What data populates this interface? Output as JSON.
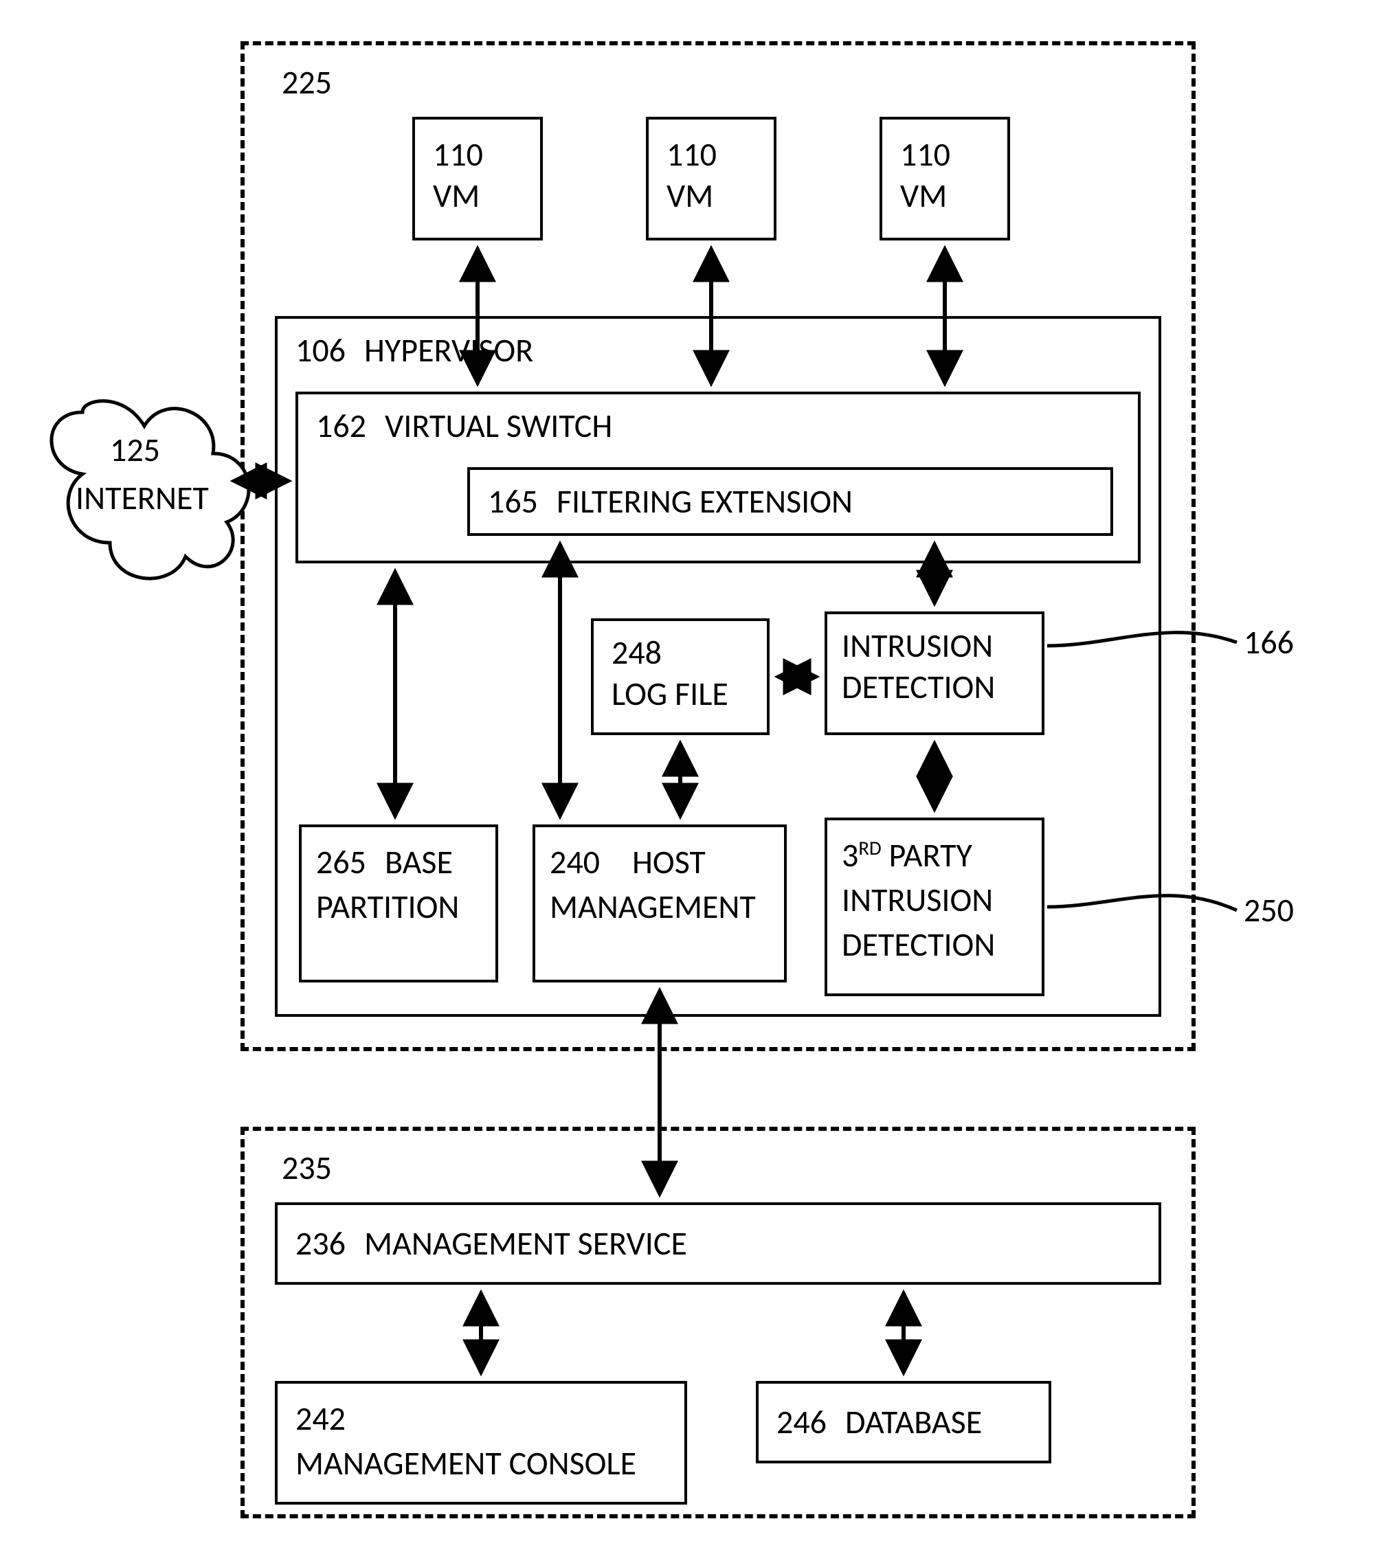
{
  "outer225": {
    "num": "225"
  },
  "vm": {
    "num": "110",
    "name": "VM"
  },
  "hypervisor": {
    "num": "106",
    "name": "HYPERVISOR"
  },
  "vswitch": {
    "num": "162",
    "name": "VIRTUAL SWITCH"
  },
  "filtering": {
    "num": "165",
    "name": "FILTERING EXTENSION"
  },
  "logfile": {
    "num": "248",
    "name": "LOG FILE"
  },
  "intrusion": {
    "line1": "INTRUSION",
    "line2": "DETECTION",
    "callout": "166"
  },
  "basepart": {
    "num": "265",
    "name1": "BASE",
    "name2": "PARTITION"
  },
  "hostmgmt": {
    "num": "240",
    "name1": "HOST",
    "name2": "MANAGEMENT"
  },
  "thirdparty": {
    "line1_html": "3<sup>RD</sup> PARTY",
    "line2": "INTRUSION",
    "line3": "DETECTION",
    "callout": "250"
  },
  "internet": {
    "num": "125",
    "name": "INTERNET"
  },
  "outer235": {
    "num": "235"
  },
  "mgmtservice": {
    "num": "236",
    "name": "MANAGEMENT SERVICE"
  },
  "mgmtconsole": {
    "num": "242",
    "name": "MANAGEMENT CONSOLE"
  },
  "database": {
    "num": "246",
    "name": "DATABASE"
  }
}
